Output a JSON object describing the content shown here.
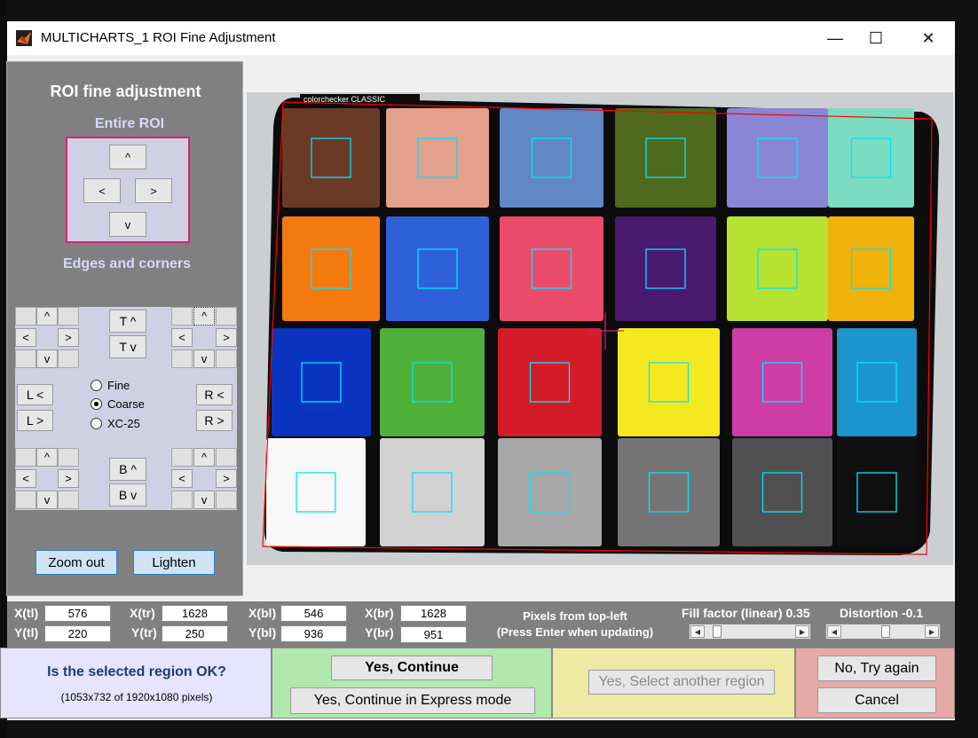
{
  "window": {
    "title": "MULTICHARTS_1 ROI Fine Adjustment",
    "minimize": "—",
    "maximize": "☐",
    "close": "✕"
  },
  "left_panel": {
    "title": "ROI fine adjustment",
    "entire_roi_label": "Entire ROI",
    "entire_up": "^",
    "entire_left": "<",
    "entire_right": ">",
    "entire_down": "v",
    "edges_label": "Edges and corners",
    "tl": {
      "up": "^",
      "left": "<",
      "right": ">",
      "down": "v"
    },
    "tr": {
      "up": "^",
      "left": "<",
      "right": ">",
      "down": "v"
    },
    "bl": {
      "up": "^",
      "left": "<",
      "right": ">",
      "down": "v"
    },
    "br": {
      "up": "^",
      "left": "<",
      "right": ">",
      "down": "v"
    },
    "top_up": "T ^",
    "top_down": "T v",
    "left_left": "L <",
    "left_right": "L >",
    "right_left": "R <",
    "right_right": "R >",
    "bottom_up": "B ^",
    "bottom_down": "B v",
    "step_options": [
      "Fine",
      "Coarse",
      "XC-25"
    ],
    "step_selected": "Coarse",
    "zoom_out": "Zoom out",
    "lighten": "Lighten"
  },
  "chart_image": {
    "header_text": "colorchecker CLASSIC",
    "patch_colors": [
      [
        "#6b3a26",
        "#e3a08c",
        "#5f88c4",
        "#4f6a1e",
        "#8a86d6",
        "#7cdcc2"
      ],
      [
        "#f57a10",
        "#2e60d8",
        "#ec4c6c",
        "#4a1a6e",
        "#b6e232",
        "#f0b20a"
      ],
      [
        "#0a34c0",
        "#4fb03a",
        "#d41c28",
        "#f4e81e",
        "#ce3ca8",
        "#1c96cc"
      ],
      [
        "#f8f8f8",
        "#d2d2d2",
        "#a8a8a8",
        "#747474",
        "#505050",
        "#101010"
      ]
    ],
    "roi_outline_color": "#ff0000",
    "sample_box_color": "#00e5ff",
    "crosshair_color": "#d0208c"
  },
  "coords": {
    "xtl_label": "X(tl)",
    "xtl": "576",
    "ytl_label": "Y(tl)",
    "ytl": "220",
    "xtr_label": "X(tr)",
    "xtr": "1628",
    "ytr_label": "Y(tr)",
    "ytr": "250",
    "xbl_label": "X(bl)",
    "xbl": "546",
    "ybl_label": "Y(bl)",
    "ybl": "936",
    "xbr_label": "X(br)",
    "xbr": "1628",
    "ybr_label": "Y(br)",
    "ybr": "951",
    "pixels_note_1": "Pixels from top-left",
    "pixels_note_2": "(Press Enter when updating)",
    "fill_factor_label": "Fill factor (linear) 0.35",
    "distortion_label": "Distortion -0.1",
    "fill_factor_level": 0.08,
    "distortion_level": 0.5
  },
  "bottom": {
    "question": "Is the selected region OK?",
    "size_note": "(1053x732 of 1920x1080 pixels)",
    "yes_continue": "Yes, Continue",
    "yes_express": "Yes, Continue in Express mode",
    "yes_select_another": "Yes, Select another region",
    "no_try_again": "No, Try again",
    "cancel": "Cancel"
  }
}
